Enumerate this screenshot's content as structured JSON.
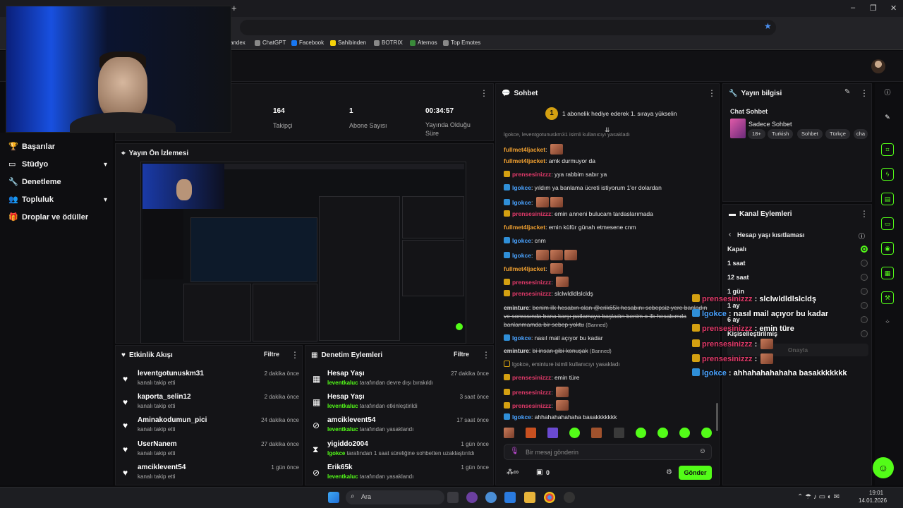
{
  "browser": {
    "bookmarks": [
      "andex",
      "ChatGPT",
      "Facebook",
      "Sahibinden",
      "BOTRIX",
      "Aternos",
      "Top Emotes"
    ],
    "new_tab_symbol": "+",
    "window_controls": [
      "–",
      "❐",
      "✕"
    ]
  },
  "nav": {
    "items": [
      {
        "label": "Başarılar",
        "icon": "trophy-icon",
        "expandable": false
      },
      {
        "label": "Stüdyo",
        "icon": "tv-icon",
        "expandable": true
      },
      {
        "label": "Denetleme",
        "icon": "wrench-icon",
        "expandable": false
      },
      {
        "label": "Topluluk",
        "icon": "users-icon",
        "expandable": true
      },
      {
        "label": "Droplar ve ödüller",
        "icon": "gift-icon",
        "expandable": false
      }
    ]
  },
  "stats": [
    {
      "value": "164",
      "label": "Takipçi"
    },
    {
      "value": "1",
      "label": "Abone Sayısı"
    },
    {
      "value": "00:34:57",
      "label": "Yayında Olduğu Süre"
    }
  ],
  "preview": {
    "title": "Yayın Ön İzlemesi"
  },
  "activity": {
    "title": "Etkinlik Akışı",
    "filter": "Filtre",
    "items": [
      {
        "name": "leventgotunuskm31",
        "sub": "kanalı takip etti",
        "time": "2 dakika önce"
      },
      {
        "name": "kaporta_selin12",
        "sub": "kanalı takip etti",
        "time": "2 dakika önce"
      },
      {
        "name": "Aminakodumun_pici",
        "sub": "kanalı takip etti",
        "time": "24 dakika önce"
      },
      {
        "name": "UserNanem",
        "sub": "kanalı takip etti",
        "time": "27 dakika önce"
      },
      {
        "name": "amciklevent54",
        "sub": "kanalı takip etti",
        "time": "1 gün önce"
      }
    ]
  },
  "moderation": {
    "title": "Denetim Eylemleri",
    "filter": "Filtre",
    "items": [
      {
        "name": "Hesap Yaşı",
        "actor": "leventkaluc",
        "sub": "tarafından devre dışı bırakıldı",
        "time": "27 dakika önce",
        "icon": "calendar-icon"
      },
      {
        "name": "Hesap Yaşı",
        "actor": "leventkaluc",
        "sub": "tarafından etkinleştirildi",
        "time": "3 saat önce",
        "icon": "calendar-icon"
      },
      {
        "name": "amciklevent54",
        "actor": "leventkaluc",
        "sub": "tarafından yasaklandı",
        "time": "17 saat önce",
        "icon": "ban-icon"
      },
      {
        "name": "yigiddo2004",
        "actor": "lgokce",
        "sub": "tarafından 1 saat süreliğine sohbetten uzaklaştırıldı",
        "time": "1 gün önce",
        "icon": "hourglass-icon"
      },
      {
        "name": "Erik65k",
        "actor": "leventkaluc",
        "sub": "tarafından yasaklandı",
        "time": "1 gün önce",
        "icon": "ban-icon"
      }
    ]
  },
  "chat": {
    "title": "Sohbet",
    "pinned": "1 abonelik hediye ederek 1. sıraya yükselin",
    "pinned_rank": "1",
    "truncated_top": "lgokce, leventgotunuskm31 isimli kullanıcıyı yasakladı",
    "messages": [
      {
        "user": "fullmet4ljacket",
        "badge": "none",
        "color": "orange",
        "text": "",
        "emotes": 1
      },
      {
        "user": "fullmet4ljacket",
        "badge": "none",
        "color": "orange",
        "text": "amk durmuyor da",
        "emotes": 0
      },
      {
        "user": "prensesinizzz",
        "badge": "crown",
        "color": "pink",
        "text": "yya rabbim sabır ya",
        "emotes": 0
      },
      {
        "user": "lgokce",
        "badge": "k",
        "color": "blue",
        "text": "yıldım ya banlama ücreti istiyorum 1'er dolardan",
        "emotes": 0
      },
      {
        "user": "lgokce",
        "badge": "k",
        "color": "blue",
        "text": "",
        "emotes": 2
      },
      {
        "user": "prensesinizzz",
        "badge": "crown",
        "color": "pink",
        "text": "emin anneni bulucam tardaslarımada",
        "emotes": 0
      },
      {
        "user": "fullmet4ljacket",
        "badge": "none",
        "color": "orange",
        "text": "emin küfür günah etmesene cnm",
        "emotes": 0
      },
      {
        "user": "lgokce",
        "badge": "k",
        "color": "blue",
        "text": "cnm",
        "emotes": 0
      },
      {
        "user": "lgokce",
        "badge": "k",
        "color": "blue",
        "text": "",
        "emotes": 3
      },
      {
        "user": "fullmet4ljacket",
        "badge": "none",
        "color": "orange",
        "text": "",
        "emotes": 1
      },
      {
        "user": "prensesinizzz",
        "badge": "crown",
        "color": "pink",
        "text": "",
        "emotes": 1
      },
      {
        "user": "prensesinizzz",
        "badge": "crown",
        "color": "pink",
        "text": "slclwldldlslcldş",
        "emotes": 0
      }
    ],
    "banned_1_user": "eminture",
    "banned_1_l1": "benim ilk hesabın olan @erik65k hesabını sebepsiz yere banladın",
    "banned_1_l2": "ve sonrasında bana karşı patlamaya başladın benim o ilk hesabımda",
    "banned_1_l3": "banlanmamda bir sebep yoktu",
    "banned_tag": "(Banned)",
    "msg_after_ban": {
      "user": "lgokce",
      "text": "nasıl mail açıyor bu kadar"
    },
    "banned_2_user": "eminture",
    "banned_2_text": "bi insan gibi konuşak",
    "system_note": "lgokce, eminture isimli kullanıcıyı yasakladı",
    "messages2": [
      {
        "user": "prensesinizzz",
        "badge": "crown",
        "color": "pink",
        "text": "emin türe",
        "emotes": 0
      },
      {
        "user": "prensesinizzz",
        "badge": "crown",
        "color": "pink",
        "text": "",
        "emotes": 1
      },
      {
        "user": "prensesinizzz",
        "badge": "crown",
        "color": "pink",
        "text": "",
        "emotes": 1
      },
      {
        "user": "lgokce",
        "badge": "k",
        "color": "blue",
        "text": "ahhahahahahaha basakkkkkkk",
        "emotes": 0
      }
    ],
    "input_placeholder": "Bir mesaj gönderin",
    "points": "0",
    "send": "Gönder"
  },
  "overlay": [
    {
      "user": "prensesinizzz",
      "badge": "crown",
      "text": "slclwldldlslcldş"
    },
    {
      "user": "lgokce",
      "badge": "k",
      "text": "nasıl mail açıyor bu kadar"
    },
    {
      "user": "prensesinizzz",
      "badge": "crown",
      "text": "emin türe"
    },
    {
      "user": "prensesinizzz",
      "badge": "crown",
      "text": ""
    },
    {
      "user": "prensesinizzz",
      "badge": "crown",
      "text": ""
    },
    {
      "user": "lgokce",
      "badge": "k",
      "text": "ahhahahahahaha basakkkkkkk"
    }
  ],
  "stream_info": {
    "title": "Yayın bilgisi",
    "category": "Chat Sohbet",
    "stream_title": "Sadece Sohbet",
    "tags": [
      "18+",
      "Turkish",
      "Sohbet",
      "Türkçe",
      "cha"
    ]
  },
  "channel_actions": {
    "title": "Kanal Eylemleri",
    "sub": "Hesap yaşı kısıtlaması",
    "options": [
      "Kapalı",
      "1 saat",
      "12 saat",
      "1 gün",
      "1 ay",
      "6 ay",
      "Kişiselleştirilmiş"
    ],
    "selected": "Kapalı",
    "confirm": "Onayla"
  },
  "taskbar": {
    "search": "Ara",
    "time": "19:01",
    "date": "14.01.2026"
  },
  "colors": {
    "accent": "#53fc18",
    "bg": "#0b0b0d",
    "panel": "#141417"
  }
}
